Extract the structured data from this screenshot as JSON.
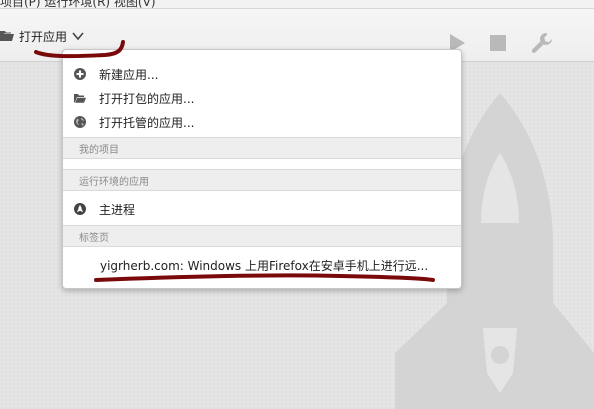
{
  "menubar": {
    "text": "项目(P)   运行环境(R)   视图(V)"
  },
  "toolbar": {
    "open_app_label": "打开应用",
    "buttons": [
      "play-icon",
      "stop-icon",
      "wrench-icon"
    ]
  },
  "dropdown": {
    "items": [
      {
        "label": "新建应用...",
        "icon": "plus-circle-icon"
      },
      {
        "label": "打开打包的应用...",
        "icon": "folder-icon"
      },
      {
        "label": "打开托管的应用...",
        "icon": "globe-icon"
      }
    ],
    "section_my_projects": "我的项目",
    "section_runtime_apps": "运行环境的应用",
    "runtime_items": [
      {
        "label": "主进程",
        "icon": "rocket-badge-icon"
      }
    ],
    "section_tabs": "标签页",
    "tab_items": [
      {
        "label": "yigrherb.com: Windows 上用Firefox在安卓手机上进行远..."
      }
    ]
  },
  "colors": {
    "annotation": "#7a0a0a",
    "toolbar_icons": "#b9b9b9",
    "watermark": "#d2d2d2"
  }
}
